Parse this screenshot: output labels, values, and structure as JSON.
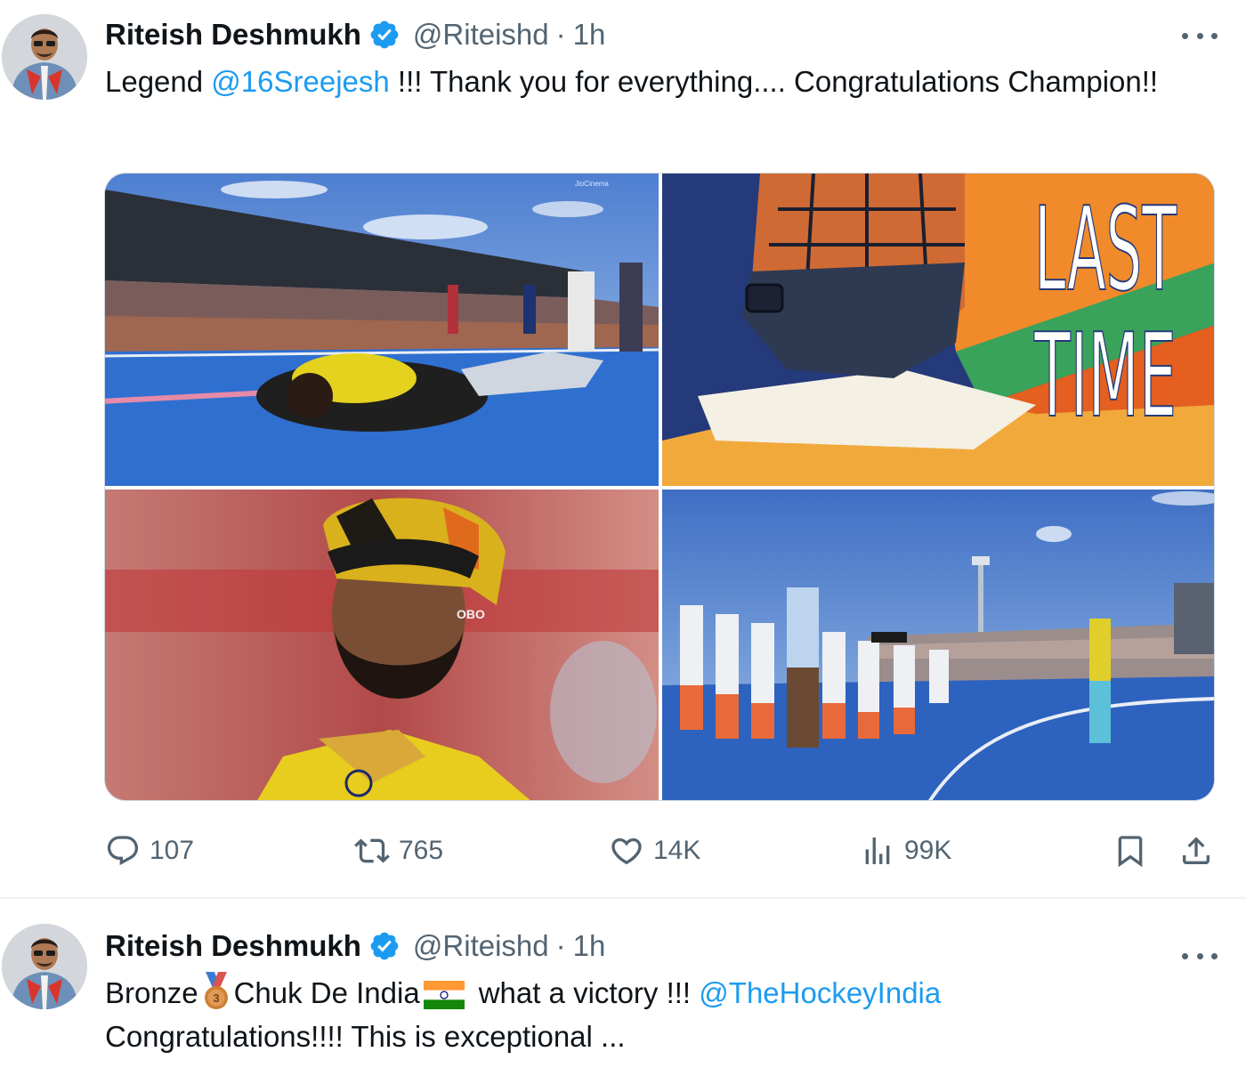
{
  "tweets": [
    {
      "author": {
        "name": "Riteish Deshmukh",
        "handle": "@Riteishd",
        "time": "1h"
      },
      "text": {
        "part1": "Legend ",
        "mention": "@16Sreejesh",
        "part2": " !!! Thank you for everything.... Congratulations Champion!!"
      },
      "media": [
        {
          "name": "goalkeeper-lying-on-pitch",
          "overlay_text": "JioCinema"
        },
        {
          "name": "last-time-illustration",
          "overlay_text": "LAST TIME"
        },
        {
          "name": "sreejesh-portrait-helmet",
          "overlay_text": "OBO"
        },
        {
          "name": "team-celebration-bowing"
        }
      ],
      "stats": {
        "replies": "107",
        "reposts": "765",
        "likes": "14K",
        "views": "99K"
      }
    },
    {
      "author": {
        "name": "Riteish Deshmukh",
        "handle": "@Riteishd",
        "time": "1h"
      },
      "text": {
        "part1": "Bronze",
        "part2": "Chuk De India",
        "part3": "what a victory !!! ",
        "mention": "@TheHockeyIndia",
        "part4": "Congratulations!!!! This is exceptional ..."
      },
      "emojis": {
        "medal": "3rd-place-medal-emoji",
        "flag": "india-flag-emoji"
      }
    }
  ],
  "icons": {
    "verified": "verified-badge-icon",
    "more": "more-icon",
    "reply": "reply-icon",
    "repost": "repost-icon",
    "like": "heart-icon",
    "views": "views-icon",
    "bookmark": "bookmark-icon",
    "share": "share-icon"
  },
  "colors": {
    "link": "#1d9bf0",
    "secondary_text": "#536471",
    "primary_text": "#0f1419",
    "verified": "#1d9bf0",
    "divider": "#eff3f4"
  }
}
